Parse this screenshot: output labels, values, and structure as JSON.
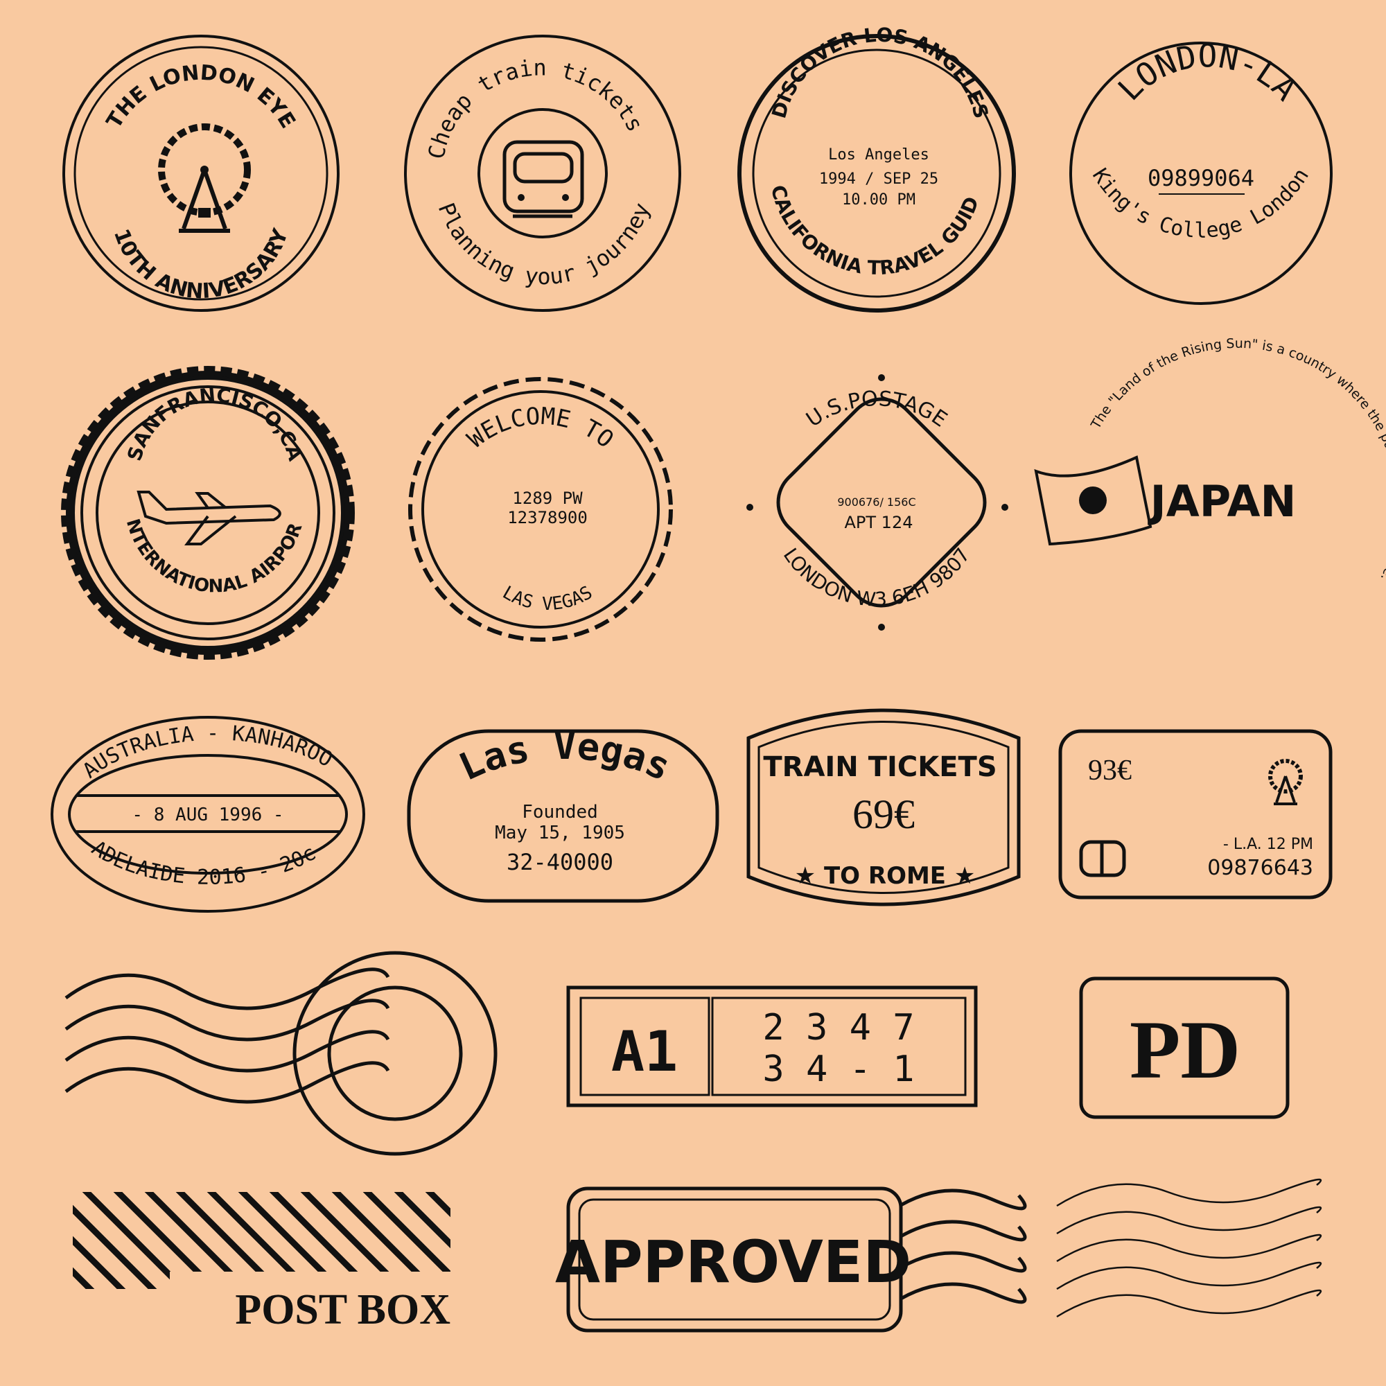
{
  "colors": {
    "background": "#f9c9a0",
    "ink": "#111111"
  },
  "stamps": {
    "london_eye": {
      "top": "THE LONDON EYE",
      "bottom": "10TH ANNIVERSARY",
      "icon": "ferris-wheel-icon"
    },
    "train_tickets_circle": {
      "top": "Cheap train tickets",
      "bottom": "Planning your journey",
      "icon": "train-front-icon"
    },
    "los_angeles": {
      "top": "DISCOVER LOS ANGELES",
      "line1": "Los Angeles",
      "line2": "1994 / SEP 25",
      "line3": "10.00 PM",
      "bottom": "CALIFORNIA TRAVEL GUIDE"
    },
    "london_la": {
      "top": "LONDON-LA",
      "number": "09899064",
      "bottom": "King's College London"
    },
    "san_francisco": {
      "top": "SANFRANCISCO,CA",
      "bottom": "INTERNATIONAL AIRPORT",
      "icon": "airplane-icon"
    },
    "welcome_las_vegas": {
      "top": "WELCOME TO",
      "line1": "1289 PW",
      "line2": "12378900",
      "bottom": "LAS VEGAS"
    },
    "us_postage": {
      "top": "U.S.POSTAGE",
      "line1": "900676/ 156C",
      "line2": "APT 124",
      "bottom": "LONDON W3 6EH 9807"
    },
    "japan": {
      "arc": "The \"Land of the Rising Sun\" is a country where the past meets the future.",
      "title": "JAPAN",
      "icon": "japan-flag-icon"
    },
    "australia": {
      "top": "AUSTRALIA - KANHAROO",
      "date": "- 8 AUG 1996 -",
      "bottom": "ADELAIDE 2016 - 20c"
    },
    "las_vegas_oval": {
      "title": "Las Vegas",
      "line1": "Founded",
      "line2": "May 15, 1905",
      "line3": "32-40000"
    },
    "train_tickets_rome": {
      "title": "TRAIN TICKETS",
      "price": "69€",
      "bottom": "★ TO ROME ★"
    },
    "ticket_card": {
      "price": "93€",
      "line1": "- L.A. 12 PM",
      "line2": "09876643",
      "icon": "ferris-wheel-icon"
    },
    "a1": {
      "code": "A1",
      "line1": "2 3 4 7",
      "line2": "3 4 - 1"
    },
    "pd": {
      "label": "PD"
    },
    "post_box": {
      "label": "POST BOX"
    },
    "approved": {
      "label": "APPROVED"
    }
  }
}
